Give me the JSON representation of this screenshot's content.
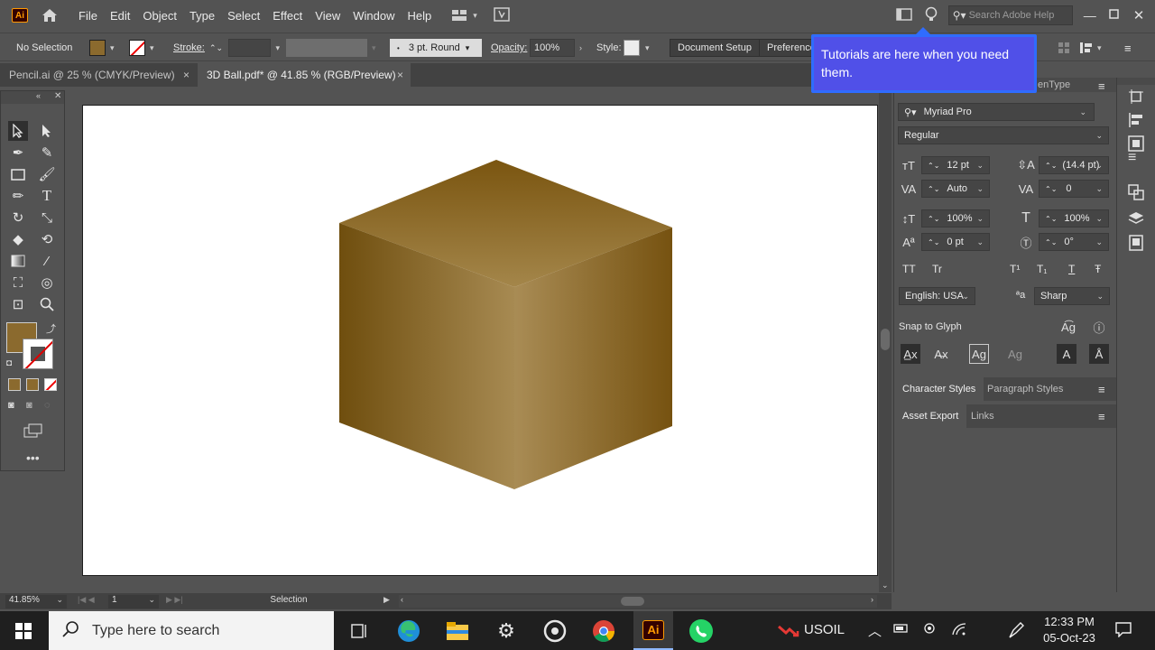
{
  "app": {
    "logo": "Ai",
    "menu": [
      "File",
      "Edit",
      "Object",
      "Type",
      "Select",
      "Effect",
      "View",
      "Window",
      "Help"
    ],
    "search_placeholder": "Search Adobe Help"
  },
  "controlbar": {
    "selection": "No Selection",
    "stroke_label": "Stroke:",
    "brush": "3 pt. Round",
    "opacity_label": "Opacity:",
    "opacity_value": "100%",
    "style_label": "Style:",
    "doc_setup": "Document Setup",
    "preferences": "Preferences"
  },
  "tabs": [
    {
      "label": "Pencil.ai @ 25 % (CMYK/Preview)",
      "close": "×"
    },
    {
      "label": "3D Ball.pdf* @ 41.85 % (RGB/Preview)",
      "close": "×"
    }
  ],
  "tooltip": {
    "text": "Tutorials are here when you need them."
  },
  "character_panel": {
    "tab_partial": "enType",
    "font_family": "Myriad Pro",
    "font_style": "Regular",
    "font_size": "12 pt",
    "leading": "(14.4 pt)",
    "kerning": "Auto",
    "tracking": "0",
    "vscale": "100%",
    "hscale": "100%",
    "baseline": "0 pt",
    "rotation": "0°",
    "language": "English: USA",
    "aa_label": "ªa",
    "antialias": "Sharp",
    "snap_label": "Snap to Glyph",
    "caps": [
      "TT",
      "Tr",
      "T¹",
      "T₁",
      "T",
      "Ŧ"
    ]
  },
  "panels": {
    "character_styles": "Character Styles",
    "paragraph_styles": "Paragraph Styles",
    "asset_export": "Asset Export",
    "links": "Links"
  },
  "statusbar": {
    "zoom": "41.85%",
    "artboard": "1",
    "mode": "Selection"
  },
  "taskbar": {
    "search_placeholder": "Type here to search",
    "weather": "USOIL",
    "time": "12:33 PM",
    "date": "05-Oct-23"
  },
  "colors": {
    "accent": "#2f6cff",
    "tooltip_bg": "#5050e8",
    "fill_swatch": "#8b6a2e",
    "cube_dark": "#6e4f0f",
    "cube_light": "#a88a50"
  }
}
